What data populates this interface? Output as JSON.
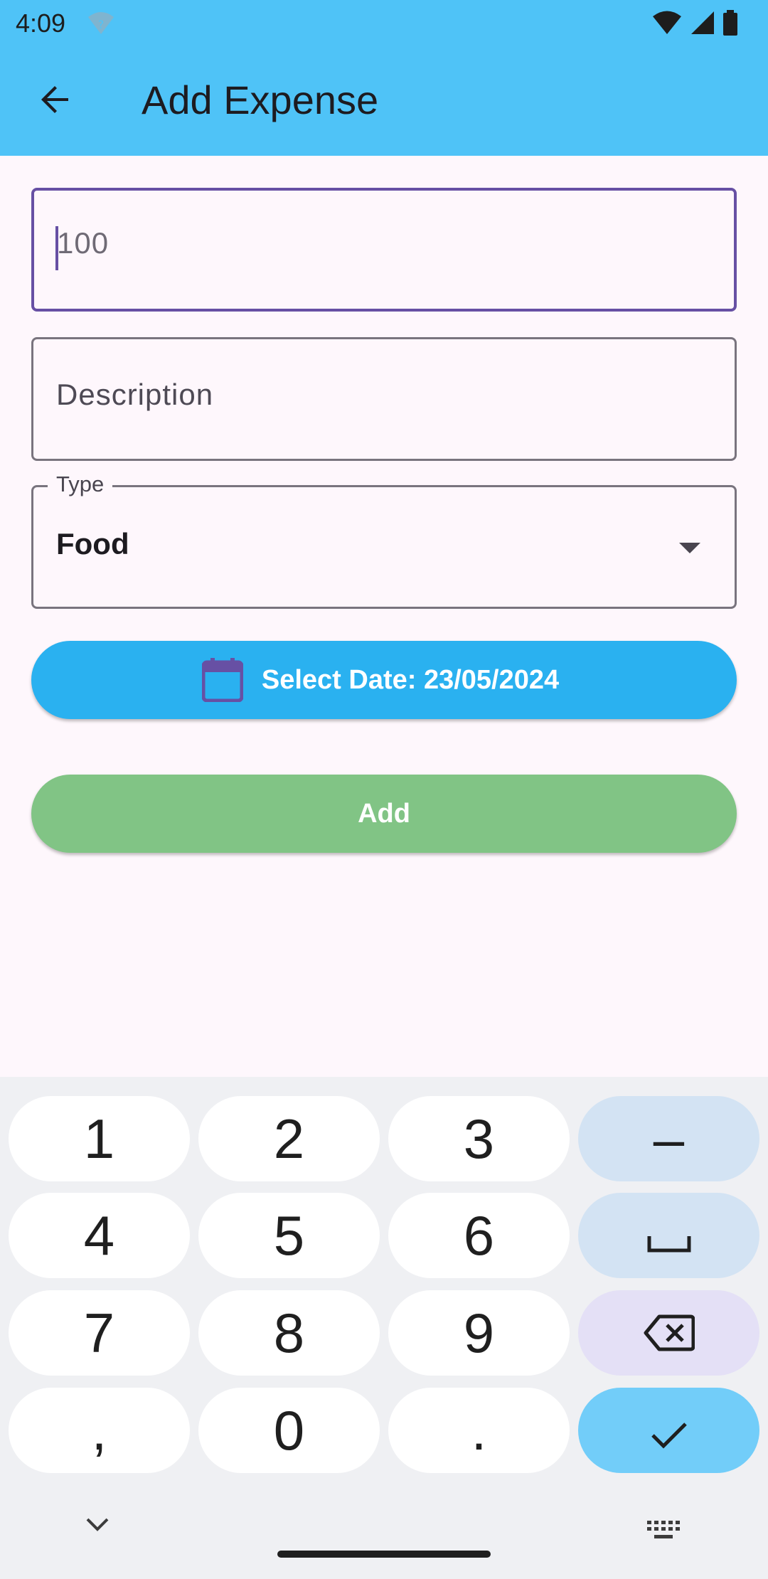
{
  "status_bar": {
    "time": "4:09",
    "wifi_icon": "wifi-question-icon",
    "icons": [
      "wifi-icon",
      "cellular-signal-icon",
      "battery-icon"
    ]
  },
  "app_bar": {
    "title": "Add Expense",
    "back_icon": "arrow-back-icon",
    "color": "#4fc3f7"
  },
  "form": {
    "amount": {
      "value": "100"
    },
    "description": {
      "placeholder": "Description"
    },
    "type": {
      "label": "Type",
      "value": "Food"
    },
    "date_button": {
      "label": "Select Date: 23/05/2024",
      "icon": "calendar-icon",
      "color": "#2ab1f0"
    },
    "add_button": {
      "label": "Add",
      "color": "#81c485"
    }
  },
  "keyboard": {
    "keys": [
      [
        "1",
        "2",
        "3",
        "–"
      ],
      [
        "4",
        "5",
        "6",
        "space"
      ],
      [
        "7",
        "8",
        "9",
        "backspace"
      ],
      [
        ",",
        "0",
        ".",
        "done"
      ]
    ]
  },
  "colors": {
    "focus": "#6750a4",
    "background": "#fef7fc"
  }
}
